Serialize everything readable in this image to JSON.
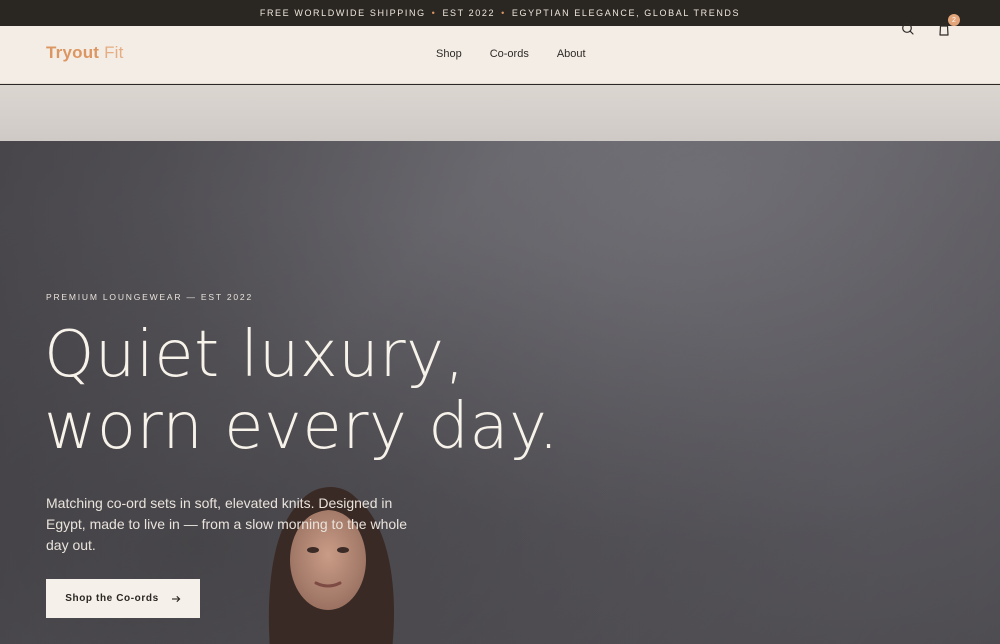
{
  "announcement": {
    "items": [
      "FREE WORLDWIDE SHIPPING",
      "EST 2022",
      "EGYPTIAN ELEGANCE, GLOBAL TRENDS"
    ],
    "separator": "•"
  },
  "header": {
    "logo_primary": "Tryout",
    "logo_secondary": "Fit",
    "nav": [
      "Shop",
      "Co-ords",
      "About"
    ],
    "cart_count": "2",
    "icons": [
      "search-icon",
      "bag-icon"
    ]
  },
  "hero": {
    "eyebrow": "PREMIUM LOUNGEWEAR — EST 2022",
    "headline_line1": "Quiet luxury,",
    "headline_line2": "worn every day.",
    "subcopy": "Matching co-ord sets in soft, elevated knits. Designed in Egypt, made to live in — from a slow morning to the whole day out.",
    "cta_label": "Shop the Co-ords",
    "cta_icon": "arrow-right-icon"
  },
  "colors": {
    "accent": "#dc9661",
    "announcement_bg": "#2a2622",
    "header_bg": "#f3ede6",
    "cta_bg": "#f5f0e9"
  }
}
